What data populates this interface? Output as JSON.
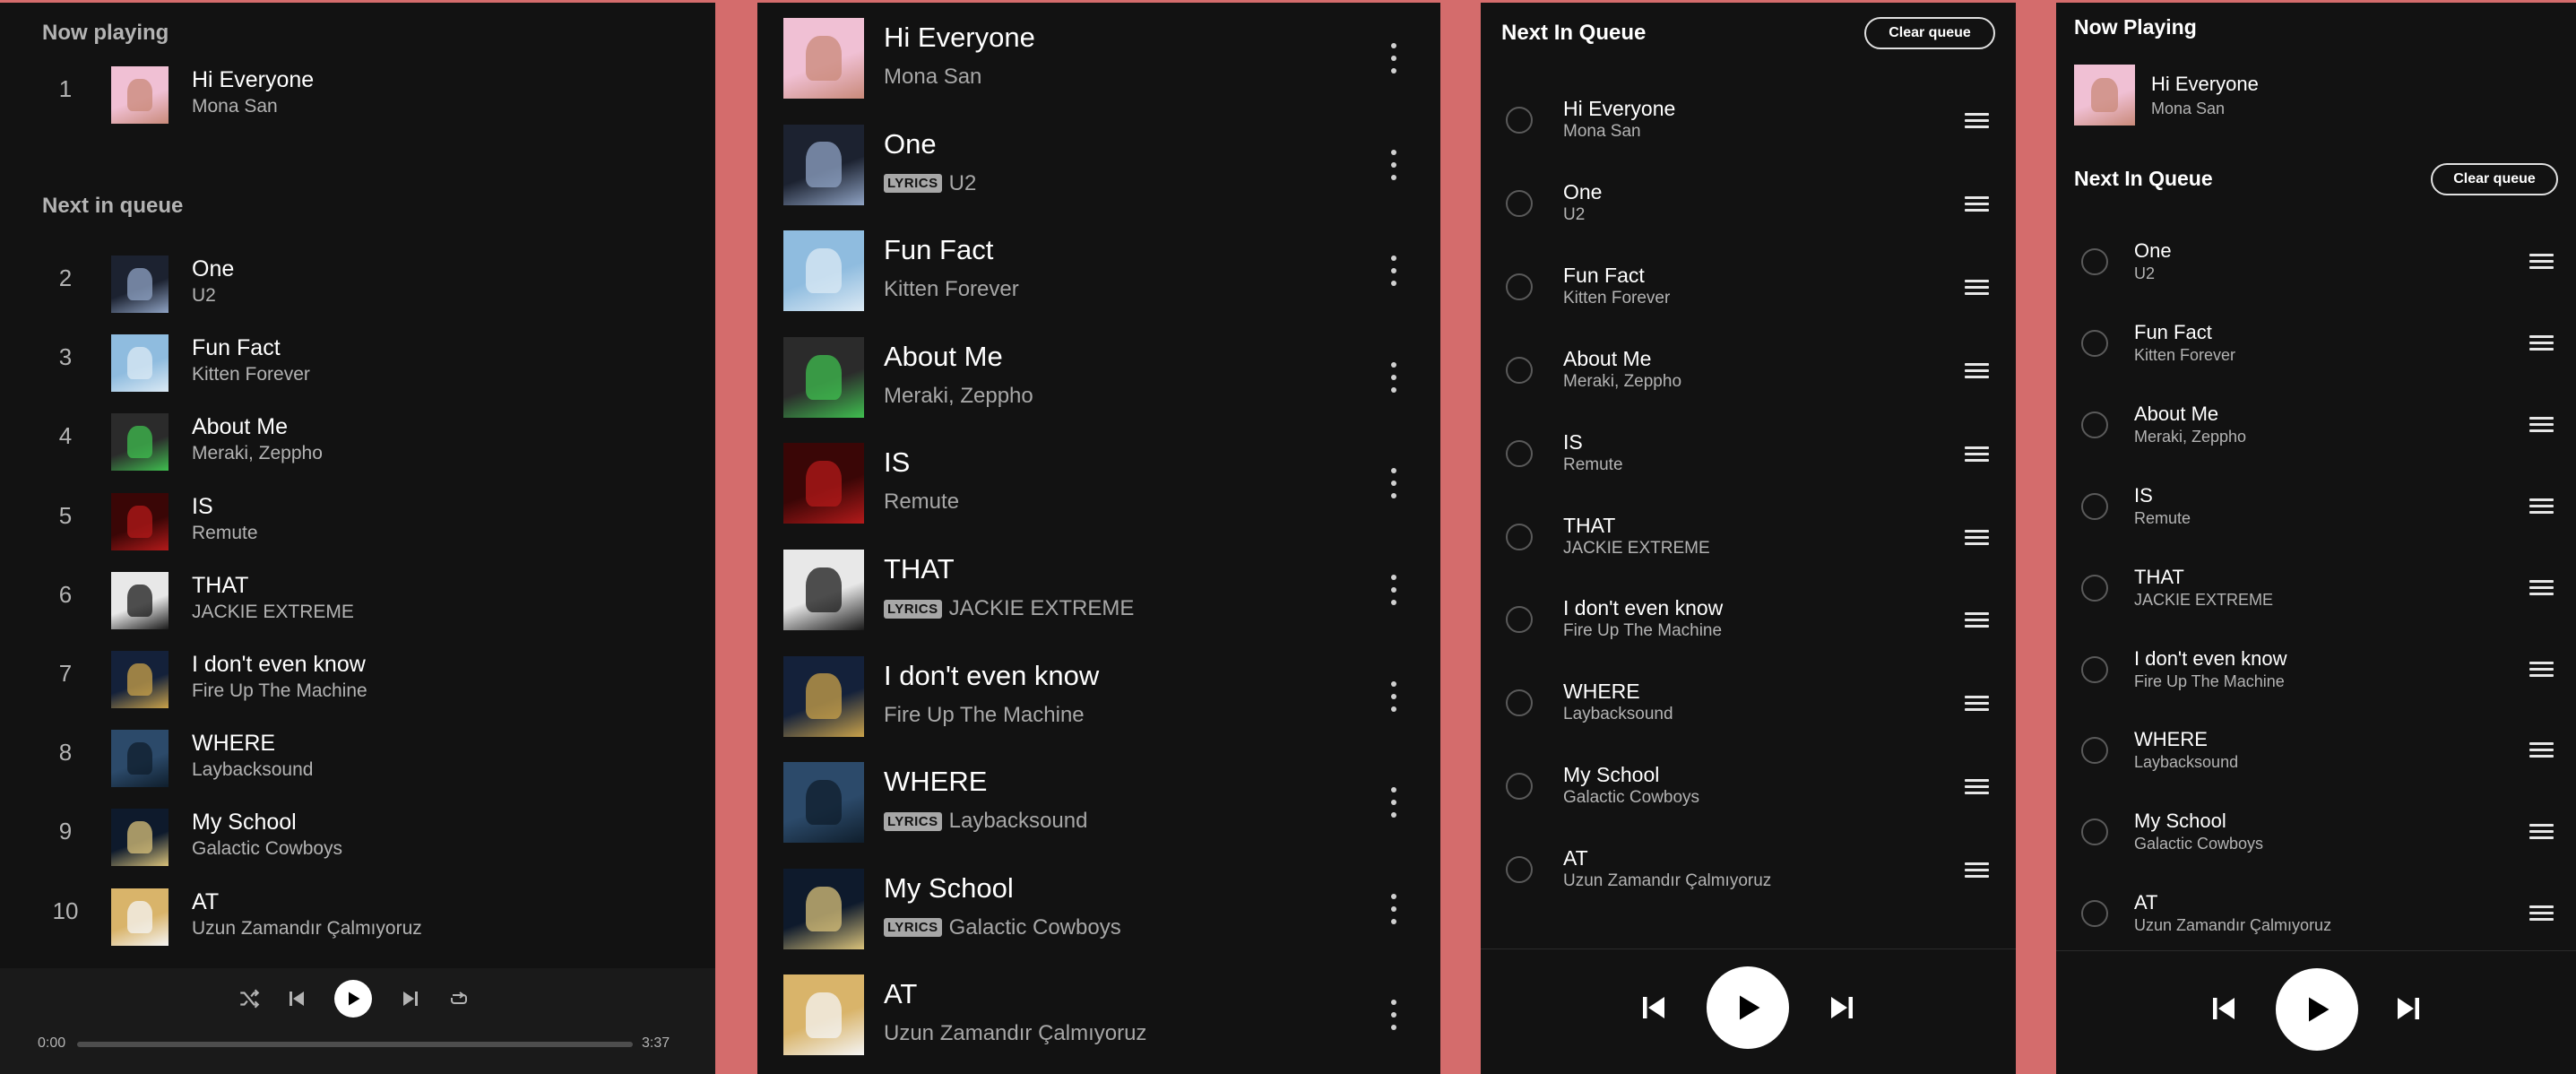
{
  "panel1": {
    "now_playing_label": "Now playing",
    "next_label": "Next in queue",
    "now_track": {
      "num": "1",
      "title": "Hi Everyone",
      "artist": "Mona San"
    },
    "queue": [
      {
        "num": "2",
        "title": "One",
        "artist": "U2"
      },
      {
        "num": "3",
        "title": "Fun Fact",
        "artist": "Kitten Forever"
      },
      {
        "num": "4",
        "title": "About Me",
        "artist": "Meraki, Zeppho"
      },
      {
        "num": "5",
        "title": "IS",
        "artist": "Remute"
      },
      {
        "num": "6",
        "title": "THAT",
        "artist": "JACKIE EXTREME"
      },
      {
        "num": "7",
        "title": "I don't even know",
        "artist": "Fire Up The Machine"
      },
      {
        "num": "8",
        "title": "WHERE",
        "artist": "Laybacksound"
      },
      {
        "num": "9",
        "title": "My School",
        "artist": "Galactic Cowboys"
      },
      {
        "num": "10",
        "title": "AT",
        "artist": "Uzun Zamandır Çalmıyoruz"
      }
    ],
    "player": {
      "time_current": "0:00",
      "time_total": "3:37",
      "progress": 0
    }
  },
  "panel2": {
    "lyrics_label": "LYRICS",
    "tracks": [
      {
        "title": "Hi Everyone",
        "artist": "Mona San",
        "lyrics": false
      },
      {
        "title": "One",
        "artist": "U2",
        "lyrics": true
      },
      {
        "title": "Fun Fact",
        "artist": "Kitten Forever",
        "lyrics": false
      },
      {
        "title": "About Me",
        "artist": "Meraki, Zeppho",
        "lyrics": false
      },
      {
        "title": "IS",
        "artist": "Remute",
        "lyrics": false
      },
      {
        "title": "THAT",
        "artist": "JACKIE EXTREME",
        "lyrics": true
      },
      {
        "title": "I don't even know",
        "artist": "Fire Up The Machine",
        "lyrics": false
      },
      {
        "title": "WHERE",
        "artist": "Laybacksound",
        "lyrics": true
      },
      {
        "title": "My School",
        "artist": "Galactic Cowboys",
        "lyrics": true
      },
      {
        "title": "AT",
        "artist": "Uzun Zamandır Çalmıyoruz",
        "lyrics": false
      }
    ]
  },
  "panel3": {
    "header": "Next In Queue",
    "clear_label": "Clear queue",
    "queue": [
      {
        "title": "Hi Everyone",
        "artist": "Mona San"
      },
      {
        "title": "One",
        "artist": "U2"
      },
      {
        "title": "Fun Fact",
        "artist": "Kitten Forever"
      },
      {
        "title": "About Me",
        "artist": "Meraki, Zeppho"
      },
      {
        "title": "IS",
        "artist": "Remute"
      },
      {
        "title": "THAT",
        "artist": "JACKIE EXTREME"
      },
      {
        "title": "I don't even know",
        "artist": "Fire Up The Machine"
      },
      {
        "title": "WHERE",
        "artist": "Laybacksound"
      },
      {
        "title": "My School",
        "artist": "Galactic Cowboys"
      },
      {
        "title": "AT",
        "artist": "Uzun Zamandır Çalmıyoruz"
      }
    ]
  },
  "panel4": {
    "now_playing_label": "Now Playing",
    "now_track": {
      "title": "Hi Everyone",
      "artist": "Mona San"
    },
    "header": "Next In Queue",
    "clear_label": "Clear queue",
    "queue": [
      {
        "title": "One",
        "artist": "U2"
      },
      {
        "title": "Fun Fact",
        "artist": "Kitten Forever"
      },
      {
        "title": "About Me",
        "artist": "Meraki, Zeppho"
      },
      {
        "title": "IS",
        "artist": "Remute"
      },
      {
        "title": "THAT",
        "artist": "JACKIE EXTREME"
      },
      {
        "title": "I don't even know",
        "artist": "Fire Up The Machine"
      },
      {
        "title": "WHERE",
        "artist": "Laybacksound"
      },
      {
        "title": "My School",
        "artist": "Galactic Cowboys"
      },
      {
        "title": "AT",
        "artist": "Uzun Zamandır Çalmıyoruz"
      }
    ]
  },
  "covers": {
    "Hi Everyone": [
      "#f0c0d4",
      "#c98a7a"
    ],
    "One": [
      "#1c2230",
      "#8fa3c4"
    ],
    "Fun Fact": [
      "#8fbcdf",
      "#dbe9f4"
    ],
    "About Me": [
      "#2b2b2b",
      "#3fbf4f"
    ],
    "IS": [
      "#3a0606",
      "#b31a1a"
    ],
    "THAT": [
      "#e8e8e8",
      "#1a1a1a"
    ],
    "I don't even know": [
      "#14213a",
      "#c9a24a"
    ],
    "WHERE": [
      "#2c4a6a",
      "#0f1e2c"
    ],
    "My School": [
      "#0e1a2c",
      "#d9c27a"
    ],
    "AT": [
      "#d9b46a",
      "#f4f4f4"
    ]
  },
  "colors": {
    "background": "#d46c6c",
    "panel": "#121212",
    "text_primary": "#ffffff",
    "text_secondary": "#b3b3b3"
  },
  "icons": [
    "shuffle-icon",
    "skip-previous-icon",
    "play-icon",
    "skip-next-icon",
    "repeat-icon",
    "more-vertical-icon",
    "drag-handle-icon",
    "radio-circle-icon"
  ]
}
